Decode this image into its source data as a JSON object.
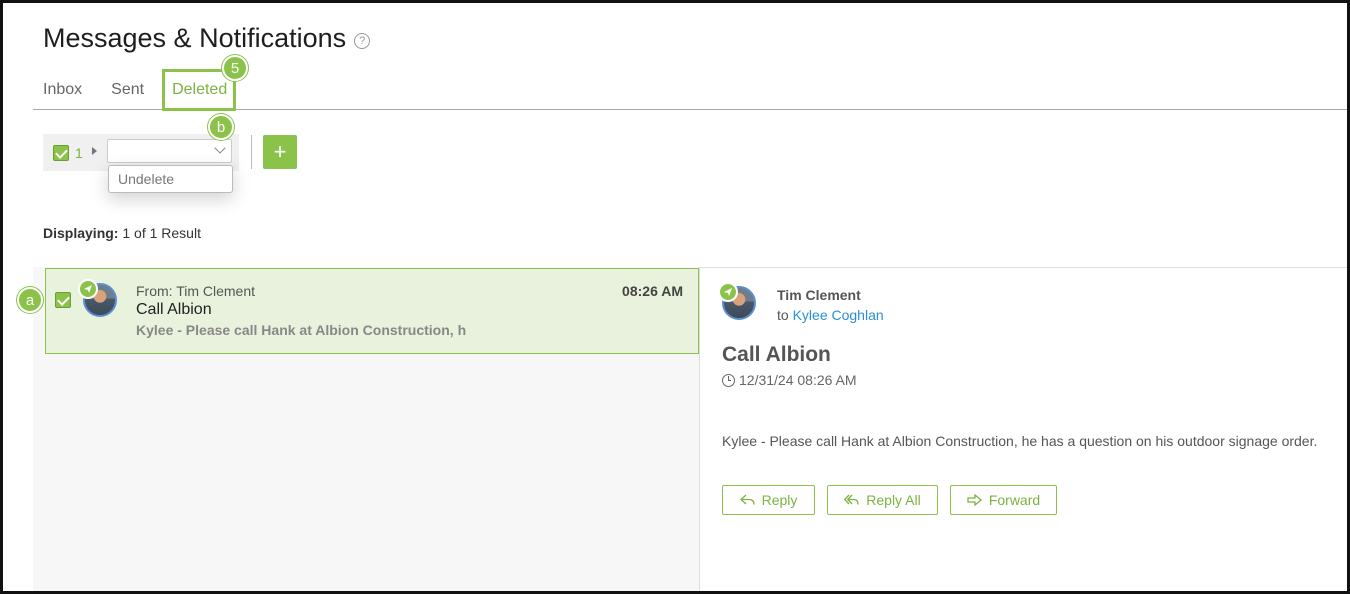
{
  "page": {
    "title": "Messages & Notifications",
    "help_icon": "?"
  },
  "tabs": [
    {
      "label": "Inbox",
      "active": false
    },
    {
      "label": "Sent",
      "active": false
    },
    {
      "label": "Deleted",
      "active": true
    }
  ],
  "callouts": {
    "step": "5",
    "b": "b",
    "a": "a"
  },
  "toolbar": {
    "selected_count": "1",
    "action_select_value": "",
    "dropdown_option": "Undelete",
    "add_button": "+"
  },
  "results": {
    "label": "Displaying:",
    "text": "1 of 1 Result"
  },
  "message": {
    "from": "From: Tim Clement",
    "subject": "Call Albion",
    "preview": "Kylee - Please call Hank at Albion Construction, h",
    "time": "08:26 AM",
    "checked": true
  },
  "detail": {
    "sender": "Tim Clement",
    "to_prefix": "to",
    "to_name": "Kylee Coghlan",
    "subject": "Call Albion",
    "date": "12/31/24 08:26 AM",
    "body": "Kylee - Please call Hank at Albion Construction, he has a question on his outdoor signage order.",
    "buttons": {
      "reply": "Reply",
      "reply_all": "Reply All",
      "forward": "Forward"
    }
  },
  "colors": {
    "accent": "#8bc34a",
    "link": "#2a8fd6"
  },
  "icons": [
    "help-icon",
    "checkbox-icon",
    "caret-right-icon",
    "chevron-down-icon",
    "plus-icon",
    "send-icon",
    "avatar",
    "clock-icon",
    "reply-icon",
    "reply-all-icon",
    "forward-icon"
  ]
}
